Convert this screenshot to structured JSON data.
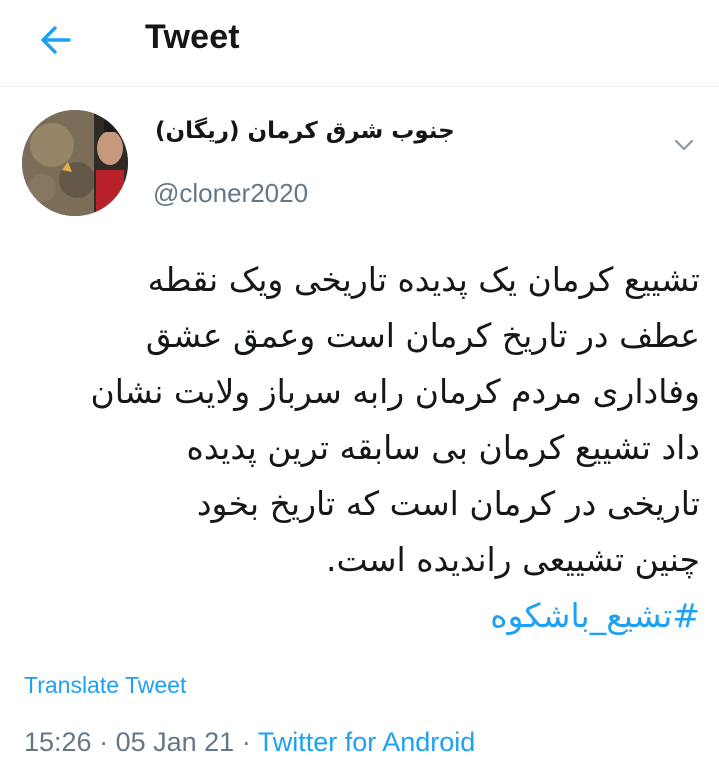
{
  "header": {
    "title": "Tweet",
    "back_icon": "arrow-left-icon",
    "accent_color": "#1da1f2"
  },
  "author": {
    "display_name": "جنوب شرق کرمان (ریگان)",
    "username": "@cloner2020",
    "menu_icon": "chevron-down-icon"
  },
  "tweet": {
    "lines": [
      "تشییع کرمان یک پدیده تاریخی ویک نقطه",
      "عطف در تاریخ کرمان است  وعمق عشق",
      "وفاداری مردم کرمان رابه سرباز ولایت نشان",
      "داد تشییع کرمان بی سابقه ترین پدیده",
      "تاریخی در کرمان است که تاریخ بخود",
      "چنین تشییعی راندیده است."
    ],
    "hashtag": "#تشیع_باشکوه",
    "translate_label": "Translate Tweet"
  },
  "meta": {
    "time": "15:26",
    "separator1": " · ",
    "date": "05 Jan 21",
    "separator2": " · ",
    "source": "Twitter for Android"
  }
}
